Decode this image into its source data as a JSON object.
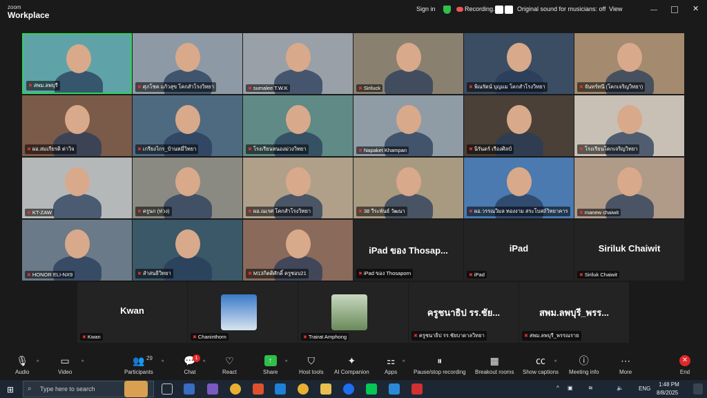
{
  "app": {
    "logo_small": "zoom",
    "logo_big": "Workplace"
  },
  "topbar": {
    "sign_in": "Sign in",
    "recording": "Recording...",
    "original_sound": "Original sound for musicians: off",
    "view": "View"
  },
  "tiles": [
    {
      "name": "สพม.ลพบุรี",
      "bg": "#5fa3a8"
    },
    {
      "name": "ศุภโชค แก้วสุข โคกสำโรงวิทยา",
      "bg": "#8d9aa6"
    },
    {
      "name": "sumalee T.W.K",
      "bg": "#9aa0a8"
    },
    {
      "name": "Siriluck",
      "bg": "#8a8070"
    },
    {
      "name": "พิณรัตน์ บุญแม โคกสำโรงวิทยา",
      "bg": "#3a4d63"
    },
    {
      "name": "จันทร์ทนี (โคกเจริญวิทยา)",
      "bg": "#a48a6e"
    },
    {
      "name": "ผอ.สมเกียรติ ต่าวิจ",
      "bg": "#7a5a48"
    },
    {
      "name": "เกรียงไกร_บ้านหมี่วิทยา",
      "bg": "#4d6a80"
    },
    {
      "name": "โรงเรียนหนองม่วงวิทยา",
      "bg": "#5f8a85"
    },
    {
      "name": "Napaket Khampan",
      "bg": "#8f9ba5"
    },
    {
      "name": "นิรันดร์ เรืองศิลป์",
      "bg": "#4a4038"
    },
    {
      "name": "โรงเรียนโคกเจริญวิทยา",
      "bg": "#c8c0b4"
    },
    {
      "name": "KT-ZAW",
      "bg": "#b5b8b8"
    },
    {
      "name": "ครูนก (ห่วง)",
      "bg": "#8a8a82"
    },
    {
      "name": "ผอ.ณเรศ โคกสำโรงวิทยา",
      "bg": "#b0a08a"
    },
    {
      "name": "38 วีระพันธ์ วัฒนา",
      "bg": "#a89a80"
    },
    {
      "name": "ผอ.วรรณวิมล ทองงาม สระโบสถ์วิทยาคาร",
      "bg": "#4a7ab0"
    },
    {
      "name": "manew chaiwit",
      "bg": "#b09a88"
    },
    {
      "name": "HONOR ELI-NX9",
      "bg": "#6a7a88"
    },
    {
      "name": "ลำสนธิวิทยา",
      "bg": "#3a5868"
    },
    {
      "name": "M13กิตติศักดิ์ ครูชอบ21",
      "bg": "#8a6a5a"
    }
  ],
  "name_tiles_row4": [
    {
      "big": "iPad ของ Thosap...",
      "name": "iPad ของ Thosaporn"
    },
    {
      "big": "iPad",
      "name": "iPad"
    },
    {
      "big": "Siriluk Chaiwit",
      "name": "Siriluk Chaiwit"
    }
  ],
  "row5": [
    {
      "big": "Kwan",
      "name": "Kwan"
    },
    {
      "big": "",
      "name": "Chaninthorn"
    },
    {
      "big": "",
      "name": "Trairat Amphong"
    },
    {
      "big": "ครูชนาธิป รร.ชัย...",
      "name": "ครูชนาธิป รร.ชัยบาดาลวิทยา"
    },
    {
      "big": "สพม.ลพบุรี_พรร...",
      "name": "สพม.ลพบุรี_พรรณราย"
    }
  ],
  "toolbar": {
    "audio": "Audio",
    "video": "Video",
    "participants": "Participants",
    "participants_count": "29",
    "chat": "Chat",
    "chat_badge": "1",
    "react": "React",
    "share": "Share",
    "host_tools": "Host tools",
    "ai_companion": "AI Companion",
    "apps": "Apps",
    "pause_recording": "Pause/stop recording",
    "breakout": "Breakout rooms",
    "captions": "Show captions",
    "meeting_info": "Meeting info",
    "more": "More",
    "end": "End"
  },
  "taskbar": {
    "search_placeholder": "Type here to search",
    "lang": "ENG",
    "time": "1:48 PM",
    "date": "8/8/2025"
  },
  "colors": {
    "active_border": "#2fd35a",
    "mic_muted": "#e33333",
    "end": "#e02828"
  }
}
